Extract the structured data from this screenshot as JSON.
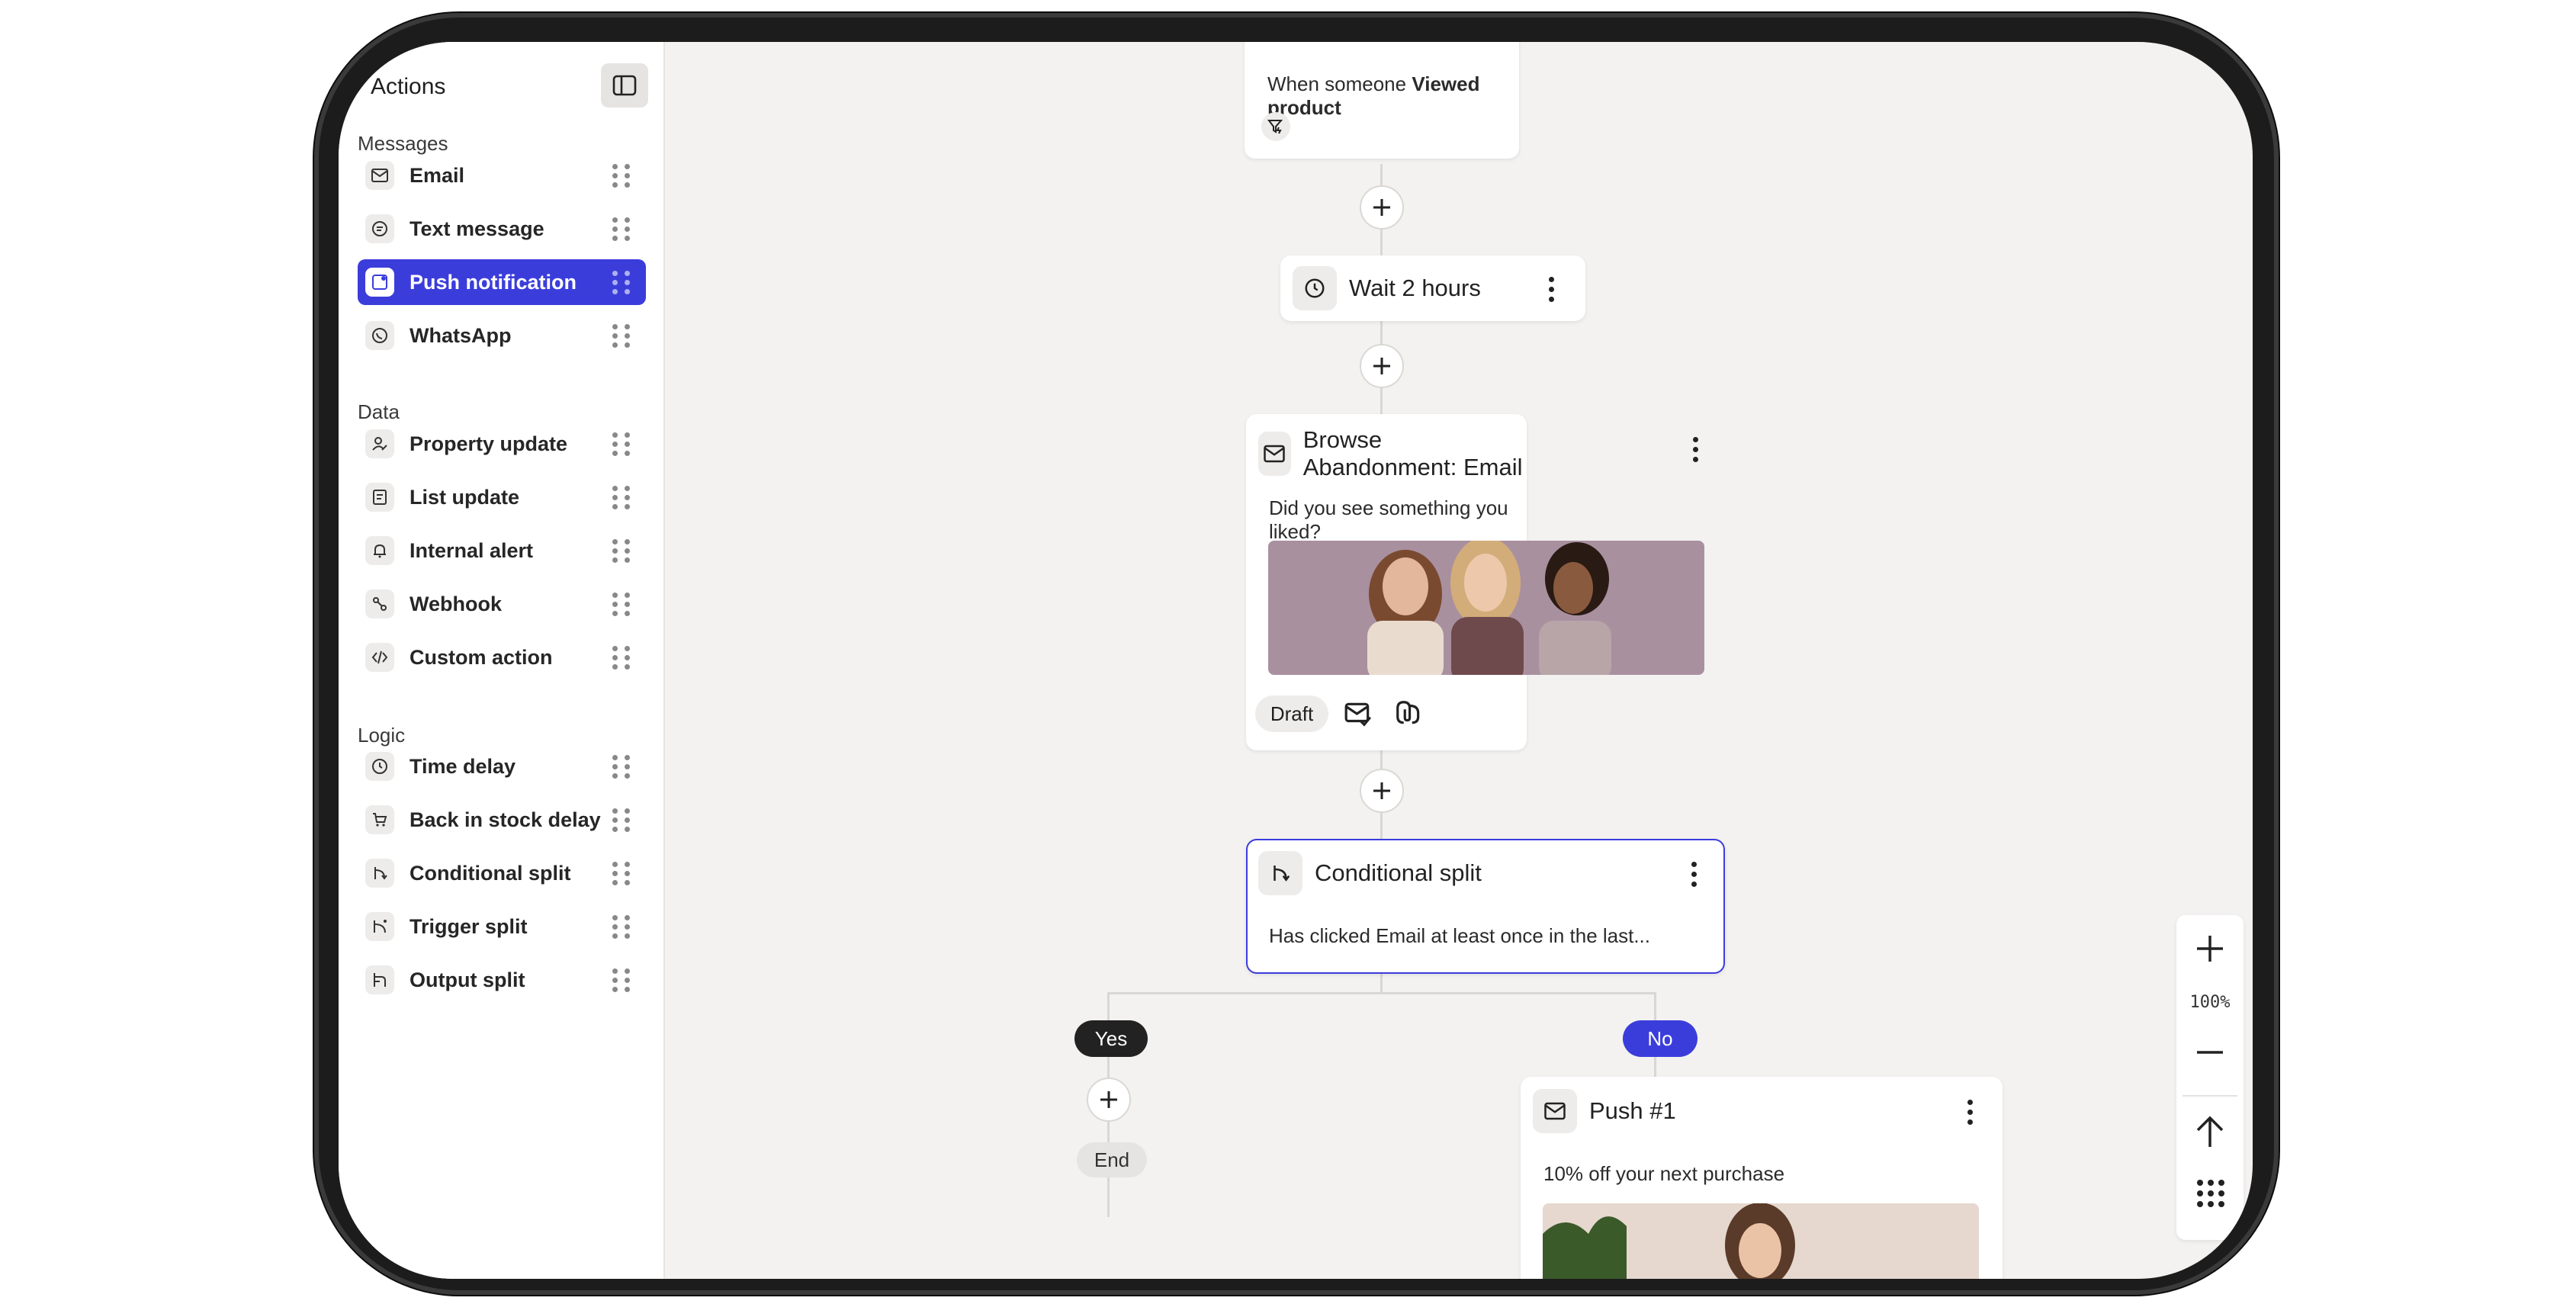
{
  "sidebar": {
    "title": "Actions",
    "sections": {
      "messages": "Messages",
      "data": "Data",
      "logic": "Logic"
    },
    "items": [
      {
        "label": "Email",
        "icon": "mail-icon"
      },
      {
        "label": "Text message",
        "icon": "chat-icon"
      },
      {
        "label": "Push notification",
        "icon": "push-icon",
        "active": true
      },
      {
        "label": "WhatsApp",
        "icon": "whatsapp-icon"
      },
      {
        "label": "Property update",
        "icon": "user-edit-icon"
      },
      {
        "label": "List update",
        "icon": "list-icon"
      },
      {
        "label": "Internal alert",
        "icon": "bell-icon"
      },
      {
        "label": "Webhook",
        "icon": "webhook-icon"
      },
      {
        "label": "Custom action",
        "icon": "code-icon"
      },
      {
        "label": "Time delay",
        "icon": "clock-icon"
      },
      {
        "label": "Back in stock delay",
        "icon": "cart-icon"
      },
      {
        "label": "Conditional split",
        "icon": "split-icon"
      },
      {
        "label": "Trigger split",
        "icon": "trigger-split-icon"
      },
      {
        "label": "Output split",
        "icon": "output-split-icon"
      }
    ]
  },
  "flow": {
    "trigger": {
      "prefix": "When someone",
      "event": "Viewed product"
    },
    "wait": {
      "title": "Wait 2 hours"
    },
    "email": {
      "title": "Browse Abandonment: Email",
      "body": "Did you see something you liked?",
      "status": "Draft"
    },
    "split": {
      "title": "Conditional split",
      "body": "Has clicked Email at least once in the last..."
    },
    "yes_label": "Yes",
    "no_label": "No",
    "end_label": "End",
    "push": {
      "title": "Push #1",
      "body": "10% off your next purchase"
    }
  },
  "zoom": {
    "level": "100%"
  },
  "colors": {
    "accent": "#3b3ddb",
    "canvas": "#f3f2f1",
    "yes_pill": "#222222"
  }
}
